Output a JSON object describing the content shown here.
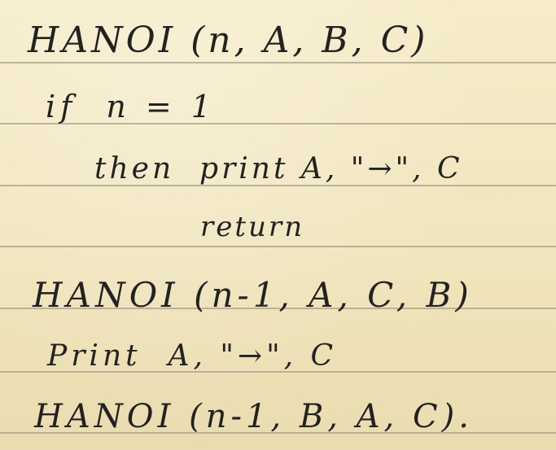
{
  "pseudocode": {
    "lines": [
      "HANOI (n, A, B, C)",
      "if  n = 1",
      "then  print A, \"→\", C",
      "return",
      "HANOI (n-1, A, C, B)",
      "Print  A, \"→\", C",
      "HANOI (n-1, B, A, C)."
    ]
  },
  "colors": {
    "paper": "#f4e9c2",
    "ink": "#222222",
    "rule": "#a9a08c"
  }
}
